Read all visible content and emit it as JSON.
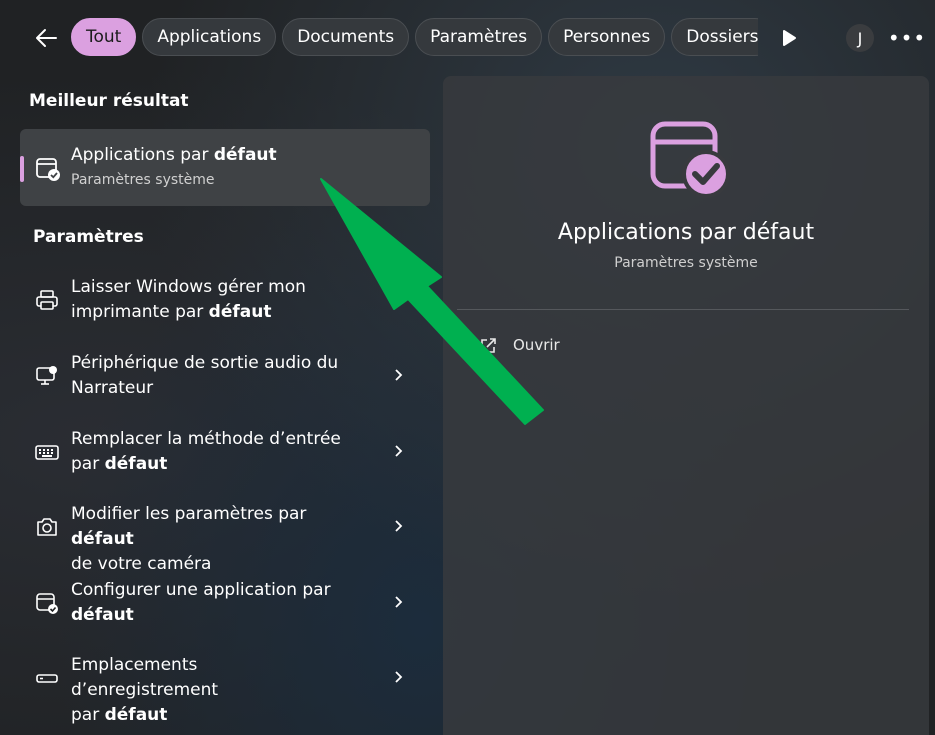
{
  "filters": [
    "Tout",
    "Applications",
    "Documents",
    "Paramètres",
    "Personnes",
    "Dossiers"
  ],
  "avatar_initial": "J",
  "accent_color": "#dba0e0",
  "best_section": "Meilleur résultat",
  "best_result": {
    "title_prefix": "Applications par ",
    "title_bold": "défaut",
    "subtitle": "Paramètres système",
    "icon": "default-apps-icon"
  },
  "settings_section": "Paramètres",
  "settings_items": [
    {
      "line1": "Laisser Windows gérer mon",
      "line2_prefix": "imprimante par ",
      "line2_bold": "défaut",
      "icon": "printer-icon"
    },
    {
      "line1": "Périphérique de sortie audio du",
      "line2_prefix": "Narrateur",
      "line2_bold": "",
      "icon": "narrator-icon"
    },
    {
      "line1": "Remplacer la méthode d’entrée",
      "line2_prefix": "par ",
      "line2_bold": "défaut",
      "icon": "keyboard-icon"
    },
    {
      "line1_prefix": "Modifier les paramètres par ",
      "line1_bold": "défaut",
      "line2_prefix": "de votre caméra",
      "line2_bold": "",
      "icon": "camera-icon"
    },
    {
      "line1": "Configurer une application par",
      "line2_prefix": "",
      "line2_bold": "défaut",
      "icon": "default-apps-icon"
    },
    {
      "line1": "Emplacements d’enregistrement",
      "line2_prefix": "par ",
      "line2_bold": "défaut",
      "icon": "storage-icon"
    }
  ],
  "preview": {
    "title": "Applications par défaut",
    "subtitle": "Paramètres système",
    "open_label": "Ouvrir"
  },
  "annotation_color": "#00b050"
}
